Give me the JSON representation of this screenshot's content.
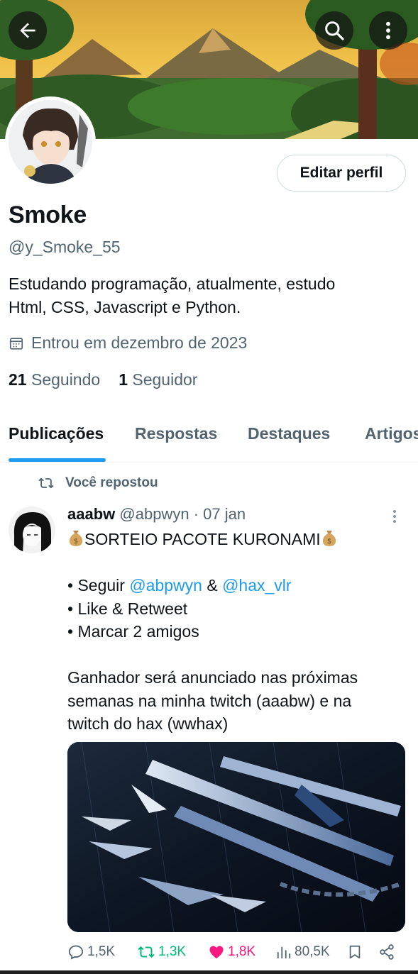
{
  "header": {
    "back_icon": "arrow-left-icon",
    "search_icon": "search-icon",
    "more_icon": "more-vertical-icon"
  },
  "profile": {
    "edit_label": "Editar perfil",
    "display_name": "Smoke",
    "handle": "@y_Smoke_55",
    "bio_line1": "Estudando programação, atualmente, estudo",
    "bio_line2": "Html, CSS, Javascript e Python.",
    "joined": "Entrou em dezembro de 2023",
    "following_count": "21",
    "following_label": "Seguindo",
    "followers_count": "1",
    "followers_label": "Seguidor"
  },
  "tabs": [
    {
      "label": "Publicações",
      "active": true
    },
    {
      "label": "Respostas",
      "active": false
    },
    {
      "label": "Destaques",
      "active": false
    },
    {
      "label": "Artigos",
      "active": false
    }
  ],
  "post": {
    "repost_label": "Você repostou",
    "author": "aaabw",
    "handle": "@abpwyn",
    "date": "· 07 jan",
    "title": "SORTEIO PACOTE KURONAMI",
    "bullet1_prefix": "• Seguir ",
    "mention1": "@abpwyn",
    "bullet1_mid": " & ",
    "mention2": "@hax_vlr",
    "bullet2": "• Like & Retweet",
    "bullet3": "• Marcar 2 amigos",
    "para_line1": "Ganhador será anunciado nas próximas",
    "para_line2": "semanas na minha twitch (aaabw) e na",
    "para_line3": "twitch do hax (wwhax)",
    "stats": {
      "replies": "1,5K",
      "reposts": "1,3K",
      "likes": "1,8K",
      "views": "80,5K"
    }
  },
  "colors": {
    "accent": "#1d9bf0",
    "repost": "#00ba7c",
    "like": "#f91880",
    "secondary_text": "#536471"
  }
}
